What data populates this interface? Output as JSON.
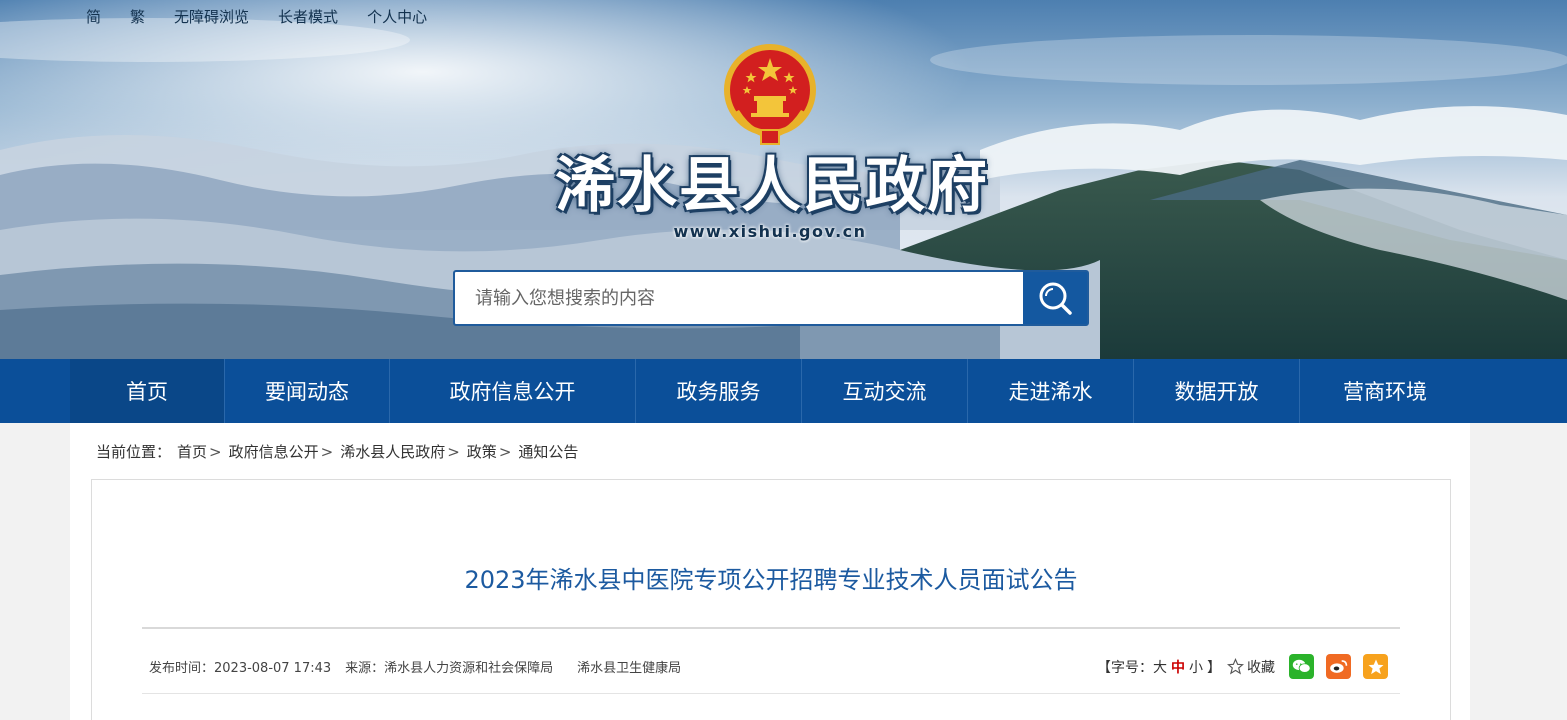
{
  "top_links": [
    "简",
    "繁",
    "无障碍浏览",
    "长者模式",
    "个人中心"
  ],
  "site": {
    "title": "浠水县人民政府",
    "url": "www.xishui.gov.cn"
  },
  "search": {
    "placeholder": "请输入您想搜索的内容",
    "button_icon": "search-icon"
  },
  "nav": {
    "items": [
      "首页",
      "要闻动态",
      "政府信息公开",
      "政务服务",
      "互动交流",
      "走进浠水",
      "数据开放",
      "营商环境"
    ]
  },
  "breadcrumb": {
    "prefix": "当前位置：",
    "items": [
      "首页",
      "政府信息公开",
      "浠水县人民政府",
      "政策",
      "通知公告"
    ],
    "separator": ">"
  },
  "article": {
    "title": "2023年浠水县中医院专项公开招聘专业技术人员面试公告",
    "publish_time": "发布时间：2023-08-07 17:43",
    "source_label": "来源：浠水县人力资源和社会保障局",
    "source_extra": "浠水县卫生健康局",
    "font_label_open": "【字号：",
    "font_large": "大",
    "font_medium": "中",
    "font_small": "小",
    "font_label_close": "】",
    "favorite": "收藏",
    "share_icons": [
      "wechat-icon",
      "weibo-icon",
      "qzone-icon"
    ]
  },
  "colors": {
    "nav_bg": "#0b4f99",
    "title_color": "#1c5aa0",
    "search_btn": "#1458a0",
    "wechat": "#2bb32b",
    "weibo": "#f06a23",
    "qzone": "#f7a21d"
  }
}
